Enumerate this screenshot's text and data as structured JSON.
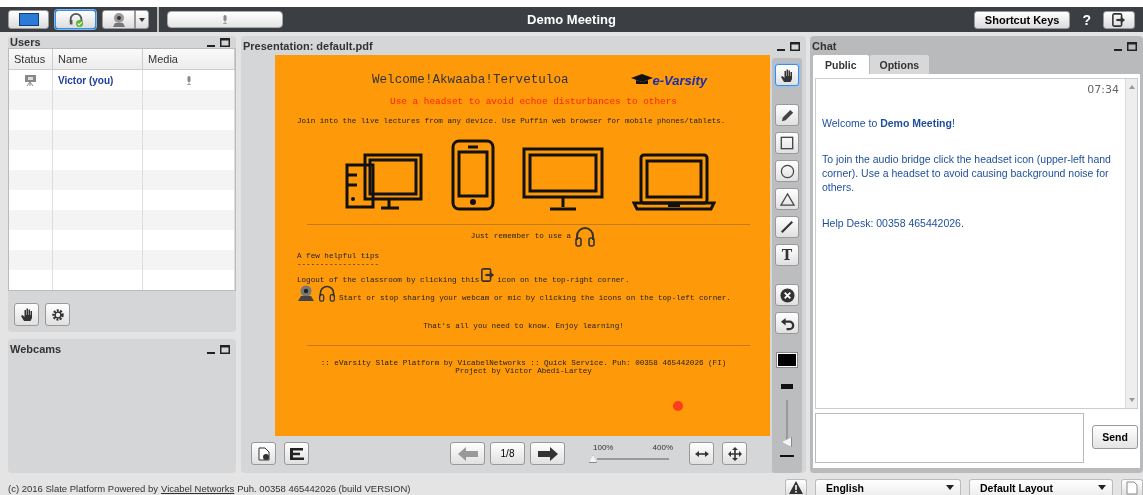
{
  "top_bar": {
    "media_buttons": [
      {
        "kind": "desktop",
        "selected": false
      },
      {
        "kind": "headset",
        "selected": true
      },
      {
        "kind": "webcam",
        "selected": false
      }
    ],
    "title": "Demo Meeting",
    "shortcut_keys": "Shortcut Keys",
    "help": "?"
  },
  "users": {
    "title": "Users",
    "columns": [
      "Status",
      "Name",
      "Media"
    ],
    "rows": [
      {
        "name": "Victor (you)",
        "presenter": true
      }
    ]
  },
  "webcams": {
    "title": "Webcams"
  },
  "presentation": {
    "title": "Presentation: default.pdf",
    "slide": {
      "heading": "Welcome!Akwaaba!Tervetuloa",
      "logo": "e-Varsity",
      "warning": "Use a headset to avoid echoe disturbances to others",
      "intro": "Join into the live lectures from any device. Use Puffin web browser for mobile phones/tablets.",
      "reminder": "Just remember to use a",
      "tips_title": "A few helpful tips",
      "tips_rule": "------------------",
      "logout_before": "Logout of the classroom by clicking this",
      "logout_after": "icon on the top-right corner.",
      "share_tip": "Start or stop sharing your webcam or mic by clicking the icons on the top-left corner.",
      "closing": "That's all you need to know. Enjoy learning!",
      "footer_1": ":: eVarsity Slate Platform by VicabelNetworks :: Quick Service. Puh: 00358 465442026 (FI)",
      "footer_2": "Project by Victor Abedi-Lartey"
    },
    "page": "1/8",
    "zoom_min": "100%",
    "zoom_max": "400%",
    "zoom": {
      "level": 0
    }
  },
  "tools": [
    {
      "kind": "hand",
      "selected": true
    },
    {
      "kind": "pencil",
      "selected": false
    },
    {
      "kind": "rectangle",
      "selected": false
    },
    {
      "kind": "ellipse",
      "selected": false
    },
    {
      "kind": "triangle",
      "selected": false
    },
    {
      "kind": "line",
      "selected": false
    },
    {
      "kind": "text",
      "glyph": "T",
      "selected": false
    },
    {
      "kind": "clear",
      "selected": false
    },
    {
      "kind": "undo",
      "selected": false
    }
  ],
  "pen": {
    "color": "#000000",
    "thickness": {
      "level": 0
    }
  },
  "chat": {
    "title": "Chat",
    "tabs": [
      {
        "label": "Public",
        "selected": true
      },
      {
        "label": "Options",
        "selected": false
      }
    ],
    "time": "07:34",
    "messages": [
      "Welcome to **Demo Meeting**!",
      "To join the audio bridge click the headset icon (upper-left hand corner).  Use a headset to avoid causing background noise for others.",
      "Help Desk: 00358 465442026."
    ],
    "send": "Send"
  },
  "footer": {
    "before": "(c) 2016 Slate Platform Powered by",
    "link": "Vicabel Networks",
    "after": "Puh. 00358 465442026 (build VERSION)",
    "language": "English",
    "layout": "Default Layout"
  }
}
